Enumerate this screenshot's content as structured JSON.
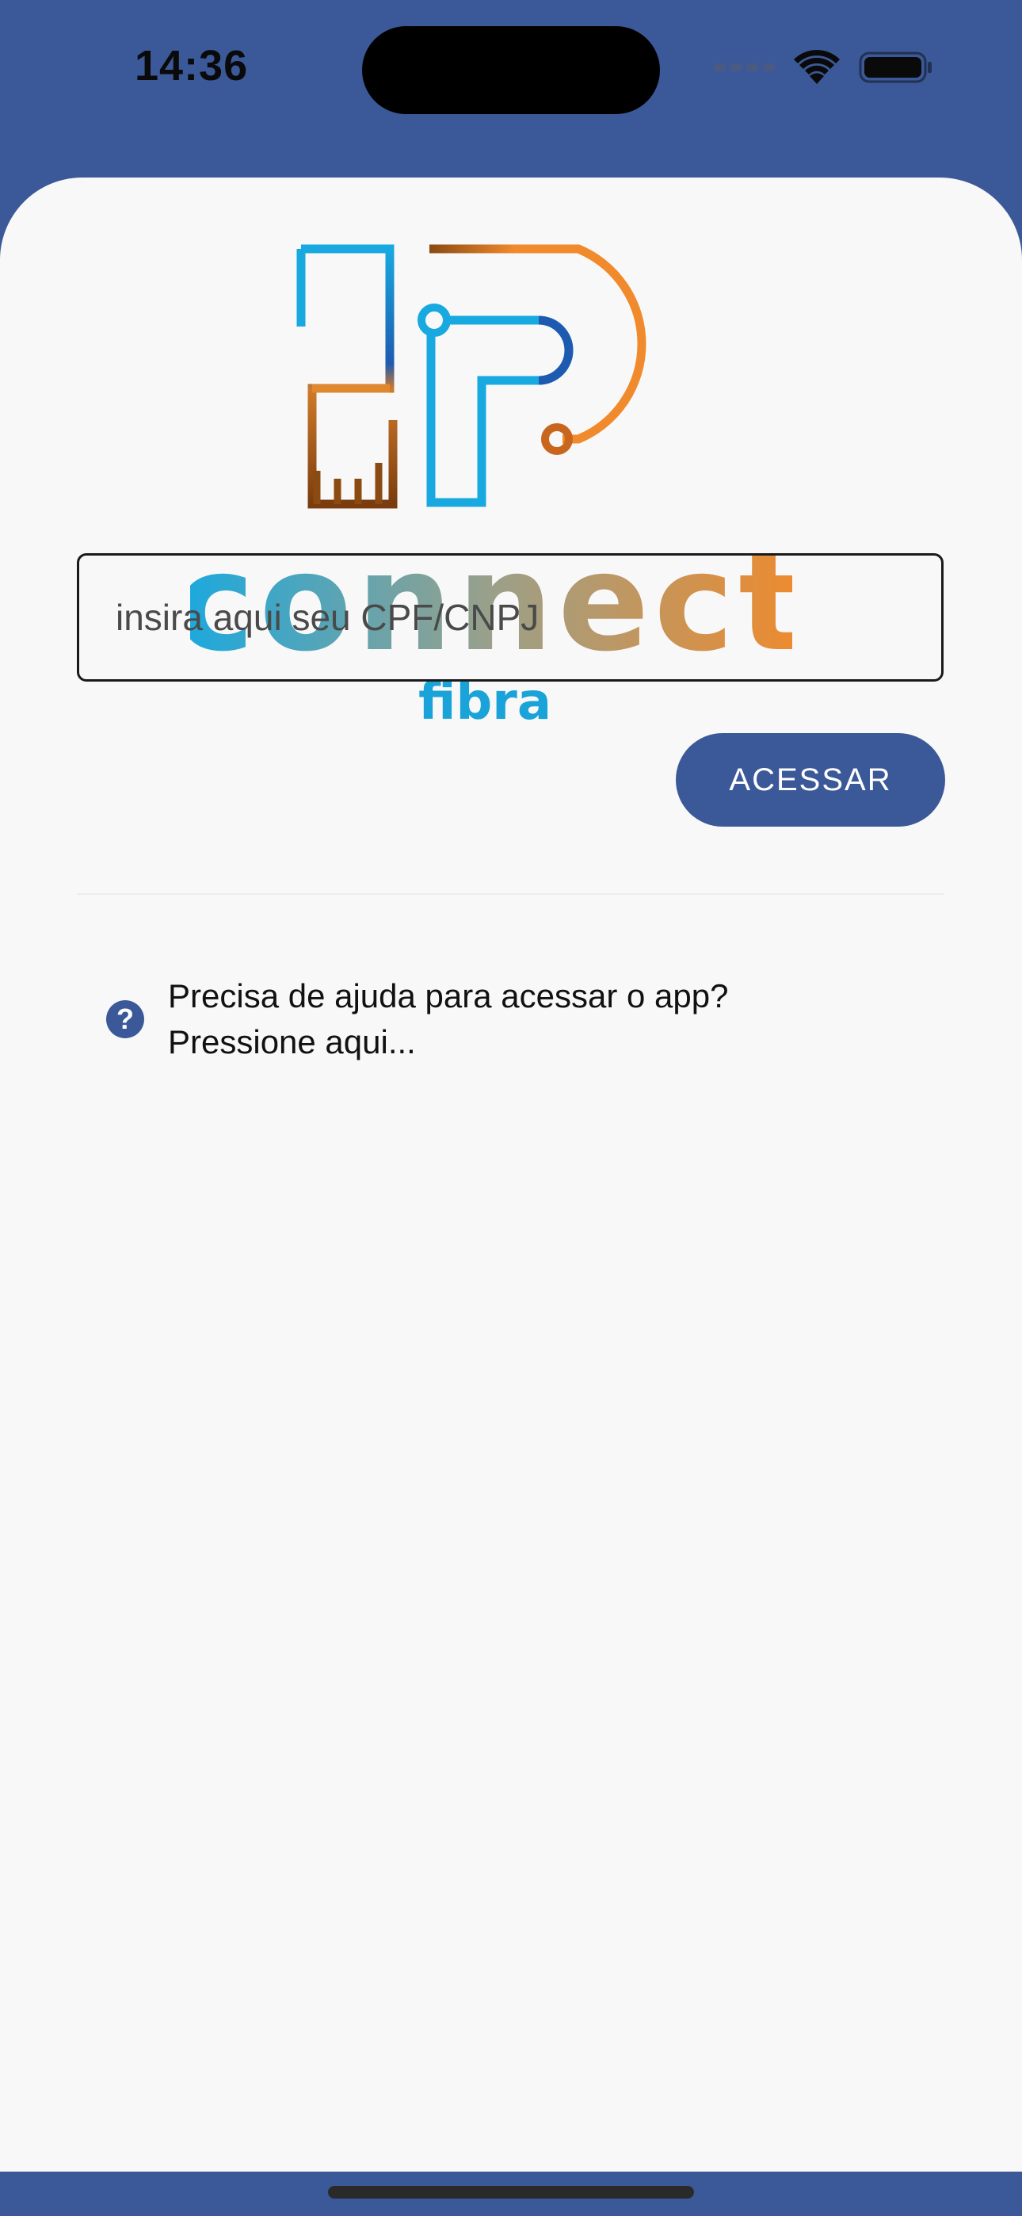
{
  "status_bar": {
    "time": "14:36"
  },
  "logo": {
    "brand": "connect",
    "sub": "fibra"
  },
  "login": {
    "cpf_placeholder": "insira aqui seu CPF/CNPJ",
    "cpf_value": "",
    "access_label": "ACESSAR"
  },
  "help": {
    "icon_glyph": "?",
    "line1": "Precisa de ajuda para acessar o app?",
    "line2": "Pressione aqui..."
  },
  "colors": {
    "primary": "#3b5998",
    "logo_blue": "#18a9e0",
    "logo_orange": "#f08a2c",
    "logo_brown": "#8a4a12"
  }
}
